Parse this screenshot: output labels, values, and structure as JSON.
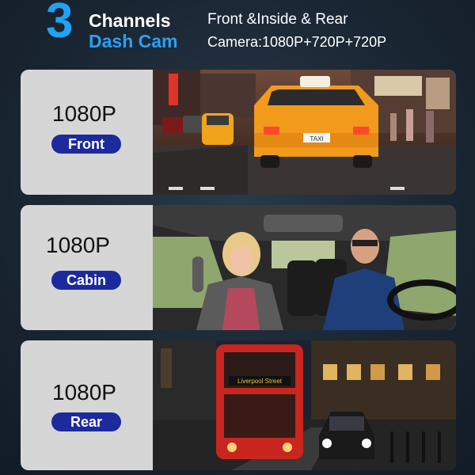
{
  "header": {
    "number": "3",
    "title_line1": "Channels",
    "title_line2": "Dash Cam",
    "subtitle_line1": "Front &Inside & Rear",
    "subtitle_line2": "Camera:1080P+720P+720P"
  },
  "panels": [
    {
      "resolution": "1080P",
      "label": "Front"
    },
    {
      "resolution": "1080P",
      "label": "Cabin"
    },
    {
      "resolution": "1080P",
      "label": "Rear"
    }
  ],
  "photos": {
    "front_taxi_plate": "TAXI",
    "rear_bus_sign": "Liverpool Street"
  },
  "colors": {
    "accent_blue": "#21a2f3",
    "label_pill": "#1c2a9e",
    "panel_bg": "#d6d6d6",
    "taxi_orange": "#f29a1c",
    "bus_red": "#c8261f"
  }
}
